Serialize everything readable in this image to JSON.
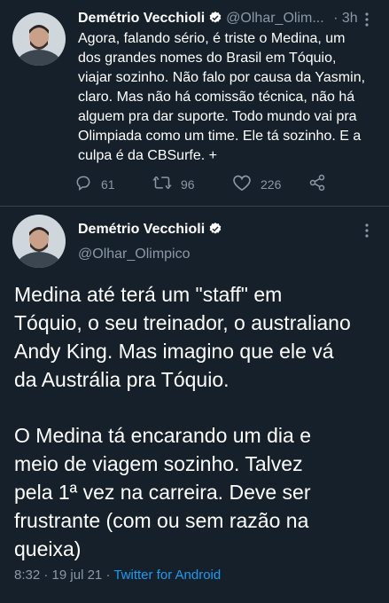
{
  "colors": {
    "background": "#15202b",
    "text": "#ffffff",
    "muted": "#8b98a5",
    "link": "#1d9bf0",
    "verified": "#ffffff"
  },
  "reply_tweet": {
    "author_name": "Demétrio Vecchioli",
    "handle": "@Olhar_Olim...",
    "dot": "·",
    "time": "3h",
    "lines": [
      "Agora, falando sério, é triste o Medina, um",
      "dos grandes nomes do Brasil em Tóquio,",
      "viajar sozinho. Não falo por causa da Yasmin,",
      "claro. Mas não há comissão técnica, não há",
      "alguem pra dar suporte. Todo mundo vai pra",
      "Olimpiada como um time. Ele tá sozinho. E a",
      "culpa é da CBSurfe. +"
    ],
    "actions": {
      "reply_icon": "reply-icon",
      "replies": "61",
      "retweet_icon": "retweet-icon",
      "retweets": "96",
      "like_icon": "heart-icon",
      "likes": "226",
      "share_icon": "share-icon"
    }
  },
  "main_tweet": {
    "author_name": "Demétrio Vecchioli",
    "handle": "@Olhar_Olimpico",
    "paragraph1": [
      "Medina até terá um \"staff\" em",
      "Tóquio, o seu treinador, o australiano",
      "Andy King. Mas imagino que ele vá",
      "da Austrália pra Tóquio."
    ],
    "paragraph2": [
      "O Medina tá encarando um dia e",
      "meio de viagem sozinho. Talvez",
      "pela 1ª vez na carreira. Deve ser",
      "frustrante (com ou sem razão na",
      "queixa)"
    ],
    "time": "8:32",
    "dot1": "·",
    "date": "19 jul 21",
    "dot2": "·",
    "source": "Twitter for Android"
  }
}
